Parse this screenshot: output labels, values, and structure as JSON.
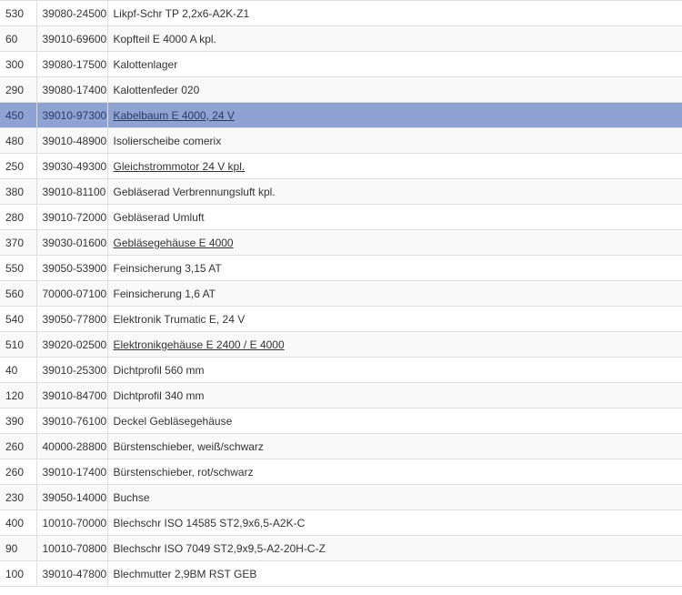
{
  "parts_table": {
    "selected_index": 4,
    "rows": [
      {
        "pos": "530",
        "number": "39080-24500",
        "description": "Likpf-Schr TP 2,2x6-A2K-Z1",
        "link": false
      },
      {
        "pos": "60",
        "number": "39010-69600",
        "description": "Kopfteil E 4000 A kpl.",
        "link": false
      },
      {
        "pos": "300",
        "number": "39080-17500",
        "description": "Kalottenlager",
        "link": false
      },
      {
        "pos": "290",
        "number": "39080-17400",
        "description": "Kalottenfeder 020",
        "link": false
      },
      {
        "pos": "450",
        "number": "39010-97300",
        "description": "Kabelbaum E 4000, 24 V",
        "link": true
      },
      {
        "pos": "480",
        "number": "39010-48900",
        "description": "Isolierscheibe comerix",
        "link": false
      },
      {
        "pos": "250",
        "number": "39030-49300",
        "description": "Gleichstrommotor 24 V kpl.",
        "link": true
      },
      {
        "pos": "380",
        "number": "39010-81100",
        "description": "Gebläserad Verbrennungsluft kpl.",
        "link": false
      },
      {
        "pos": "280",
        "number": "39010-72000",
        "description": "Gebläserad Umluft",
        "link": false
      },
      {
        "pos": "370",
        "number": "39030-01600",
        "description": "Gebläsegehäuse E 4000",
        "link": true
      },
      {
        "pos": "550",
        "number": "39050-53900",
        "description": "Feinsicherung 3,15 AT",
        "link": false
      },
      {
        "pos": "560",
        "number": "70000-07100",
        "description": "Feinsicherung 1,6 AT",
        "link": false
      },
      {
        "pos": "540",
        "number": "39050-77800",
        "description": "Elektronik Trumatic E, 24 V",
        "link": false
      },
      {
        "pos": "510",
        "number": "39020-02500",
        "description": "Elektronikgehäuse E 2400 / E 4000",
        "link": true
      },
      {
        "pos": "40",
        "number": "39010-25300",
        "description": "Dichtprofil 560 mm",
        "link": false
      },
      {
        "pos": "120",
        "number": "39010-84700",
        "description": "Dichtprofil 340 mm",
        "link": false
      },
      {
        "pos": "390",
        "number": "39010-76100",
        "description": "Deckel Gebläsegehäuse",
        "link": false
      },
      {
        "pos": "260",
        "number": "40000-28800",
        "description": "Bürstenschieber, weiß/schwarz",
        "link": false
      },
      {
        "pos": "260",
        "number": "39010-17400",
        "description": "Bürstenschieber, rot/schwarz",
        "link": false
      },
      {
        "pos": "230",
        "number": "39050-14000",
        "description": "Buchse",
        "link": false
      },
      {
        "pos": "400",
        "number": "10010-70000",
        "description": "Blechschr ISO 14585 ST2,9x6,5-A2K-C",
        "link": false
      },
      {
        "pos": "90",
        "number": "10010-70800",
        "description": "Blechschr ISO 7049 ST2,9x9,5-A2-20H-C-Z",
        "link": false
      },
      {
        "pos": "100",
        "number": "39010-47800",
        "description": "Blechmutter 2,9BM RST GEB",
        "link": false
      }
    ]
  },
  "colors": {
    "selected_row": "#8fa2d4",
    "zebra_row": "#f9f9f9",
    "border": "#dddddd",
    "text": "#333333"
  }
}
